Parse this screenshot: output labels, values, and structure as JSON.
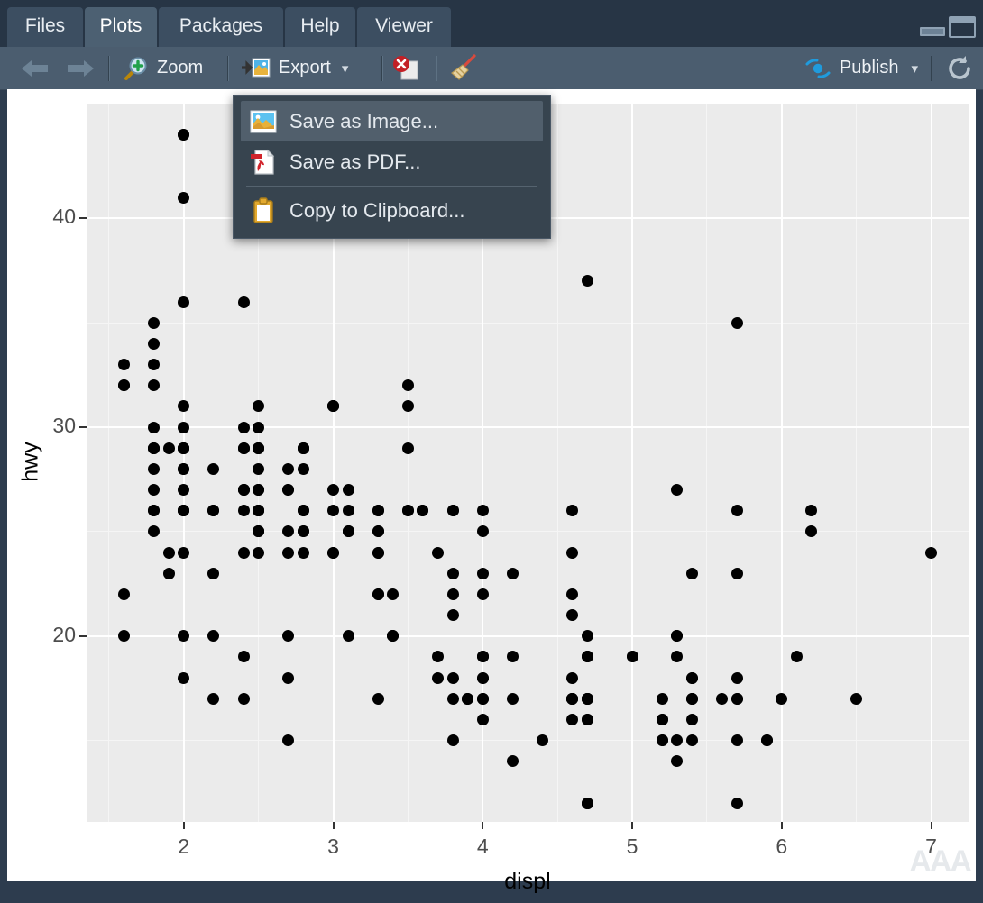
{
  "window": {
    "minimize_label": "minimize",
    "maximize_label": "maximize"
  },
  "tabs": [
    {
      "label": "Files",
      "active": false
    },
    {
      "label": "Plots",
      "active": true
    },
    {
      "label": "Packages",
      "active": false
    },
    {
      "label": "Help",
      "active": false
    },
    {
      "label": "Viewer",
      "active": false
    }
  ],
  "toolbar": {
    "back_icon": "left-arrow-icon",
    "forward_icon": "right-arrow-icon",
    "zoom_label": "Zoom",
    "zoom_icon": "magnifier-plus-icon",
    "export_label": "Export",
    "export_icon": "export-image-icon",
    "export_caret": "▾",
    "remove_plot_icon": "remove-plot-icon",
    "clear_plots_icon": "broom-icon",
    "publish_label": "Publish",
    "publish_icon": "publish-icon",
    "publish_caret": "▾",
    "refresh_icon": "refresh-icon"
  },
  "export_menu": {
    "items": [
      {
        "label": "Save as Image...",
        "icon": "image-file-icon",
        "highlighted": true
      },
      {
        "label": "Save as PDF...",
        "icon": "pdf-file-icon",
        "highlighted": false
      },
      {
        "label": "Copy to Clipboard...",
        "icon": "clipboard-icon",
        "highlighted": false
      }
    ],
    "separator_after_index": 1
  },
  "watermark": {
    "text": "AAA"
  },
  "colors": {
    "panel_bg": "#ebebeb",
    "grid_major": "#ffffff",
    "grid_minor": "#f5f5f5",
    "point": "#000000",
    "toolbar_bg": "#4b5d6f",
    "tabbar_bg": "#273545",
    "active_tab_bg": "#4c6072",
    "menu_bg": "#37444f",
    "menu_highlight": "#515f6c",
    "publish_accent": "#1f9bdd",
    "frame": "#31475e"
  },
  "chart_data": {
    "type": "scatter",
    "title": "",
    "xlabel": "displ",
    "ylabel": "hwy",
    "xlim": [
      1.35,
      7.25
    ],
    "ylim": [
      11.1,
      45.5
    ],
    "xticks": [
      2,
      3,
      4,
      5,
      6,
      7
    ],
    "yticks": [
      20,
      30,
      40
    ],
    "x_minor_ticks": [
      1.5,
      2.5,
      3.5,
      4.5,
      5.5,
      6.5
    ],
    "y_minor_ticks": [
      15,
      25,
      35,
      45
    ],
    "grid": true,
    "legend": "none",
    "point_color": "#000000",
    "point_size": 13,
    "x": [
      1.8,
      1.8,
      2.0,
      2.0,
      2.8,
      2.8,
      3.1,
      1.8,
      1.8,
      2.0,
      2.0,
      2.8,
      2.8,
      3.1,
      3.1,
      2.8,
      3.1,
      4.2,
      5.3,
      5.3,
      5.3,
      5.7,
      6.0,
      5.7,
      5.7,
      6.2,
      6.2,
      7.0,
      5.3,
      5.3,
      5.7,
      6.5,
      2.4,
      2.4,
      3.1,
      3.5,
      3.6,
      2.4,
      3.0,
      3.3,
      3.3,
      3.3,
      3.3,
      3.3,
      3.8,
      3.8,
      3.8,
      4.0,
      3.7,
      3.7,
      3.9,
      3.9,
      4.7,
      4.7,
      4.7,
      5.2,
      5.2,
      3.9,
      4.7,
      4.7,
      4.7,
      5.2,
      5.7,
      5.9,
      4.7,
      4.7,
      4.7,
      4.7,
      4.7,
      4.7,
      5.2,
      5.2,
      5.7,
      5.9,
      4.6,
      5.4,
      5.4,
      4.0,
      4.0,
      4.6,
      5.0,
      4.2,
      4.2,
      4.6,
      4.6,
      4.6,
      5.4,
      5.4,
      3.8,
      3.8,
      4.0,
      4.0,
      4.6,
      4.6,
      4.6,
      4.6,
      5.4,
      1.6,
      1.6,
      1.6,
      1.6,
      1.6,
      1.8,
      1.8,
      1.8,
      2.0,
      2.4,
      2.4,
      2.4,
      2.4,
      2.5,
      2.5,
      3.3,
      2.0,
      2.0,
      2.0,
      2.0,
      2.7,
      2.7,
      2.7,
      3.0,
      3.7,
      4.0,
      4.7,
      4.7,
      4.7,
      5.7,
      6.1,
      4.0,
      4.2,
      4.4,
      4.6,
      5.4,
      5.4,
      5.4,
      4.0,
      4.0,
      4.6,
      5.0,
      2.4,
      2.4,
      2.5,
      2.5,
      3.5,
      3.5,
      3.0,
      3.0,
      3.5,
      3.3,
      3.3,
      4.0,
      5.6,
      3.1,
      3.8,
      3.8,
      3.8,
      5.3,
      2.5,
      2.5,
      2.5,
      2.5,
      2.5,
      2.5,
      2.2,
      2.2,
      2.5,
      2.5,
      2.5,
      2.5,
      2.5,
      2.5,
      2.7,
      2.7,
      3.4,
      3.4,
      4.0,
      4.7,
      2.2,
      2.2,
      2.4,
      2.4,
      3.0,
      3.0,
      3.5,
      2.2,
      2.2,
      2.4,
      2.4,
      3.0,
      3.0,
      3.3,
      1.8,
      1.8,
      1.8,
      1.8,
      1.8,
      4.7,
      5.7,
      2.7,
      2.7,
      2.7,
      3.4,
      3.4,
      4.0,
      4.0,
      2.0,
      2.0,
      2.0,
      2.0,
      2.8,
      1.9,
      2.0,
      2.0,
      2.0,
      2.0,
      2.5,
      2.5,
      2.8,
      2.8,
      1.9,
      1.9,
      2.0,
      2.0,
      2.5,
      2.5,
      1.8,
      1.8,
      2.0,
      2.0,
      2.8,
      2.8,
      3.6
    ],
    "y": [
      29,
      29,
      31,
      30,
      26,
      26,
      27,
      26,
      25,
      28,
      27,
      25,
      25,
      25,
      25,
      24,
      25,
      23,
      20,
      15,
      20,
      17,
      17,
      26,
      23,
      26,
      25,
      24,
      19,
      14,
      15,
      17,
      27,
      30,
      26,
      29,
      26,
      24,
      24,
      22,
      22,
      24,
      24,
      17,
      22,
      21,
      23,
      23,
      19,
      18,
      17,
      17,
      19,
      19,
      12,
      17,
      15,
      17,
      17,
      12,
      17,
      16,
      18,
      15,
      16,
      12,
      17,
      17,
      16,
      12,
      15,
      16,
      17,
      15,
      17,
      17,
      18,
      17,
      19,
      17,
      19,
      19,
      17,
      17,
      17,
      16,
      16,
      17,
      15,
      17,
      26,
      25,
      26,
      24,
      21,
      22,
      23,
      22,
      20,
      33,
      32,
      32,
      29,
      32,
      34,
      36,
      36,
      29,
      26,
      27,
      30,
      31,
      26,
      26,
      28,
      26,
      29,
      28,
      27,
      24,
      24,
      24,
      22,
      19,
      20,
      17,
      12,
      19,
      18,
      14,
      15,
      18,
      18,
      15,
      17,
      16,
      18,
      17,
      19,
      19,
      17,
      29,
      27,
      31,
      32,
      27,
      26,
      26,
      25,
      25,
      17,
      17,
      20,
      18,
      26,
      26,
      27,
      28,
      25,
      25,
      24,
      27,
      25,
      26,
      23,
      26,
      26,
      26,
      26,
      25,
      27,
      25,
      27,
      20,
      20,
      19,
      17,
      20,
      17,
      29,
      27,
      31,
      31,
      26,
      26,
      28,
      27,
      29,
      31,
      31,
      26,
      26,
      27,
      30,
      33,
      35,
      37,
      35,
      15,
      18,
      20,
      20,
      22,
      17,
      19,
      18,
      20,
      29,
      26,
      29,
      29,
      24,
      44,
      29,
      26,
      29,
      29,
      29,
      29,
      23,
      24,
      44,
      41,
      29,
      26,
      28,
      29,
      29,
      29,
      28,
      29,
      26,
      26,
      26
    ]
  }
}
